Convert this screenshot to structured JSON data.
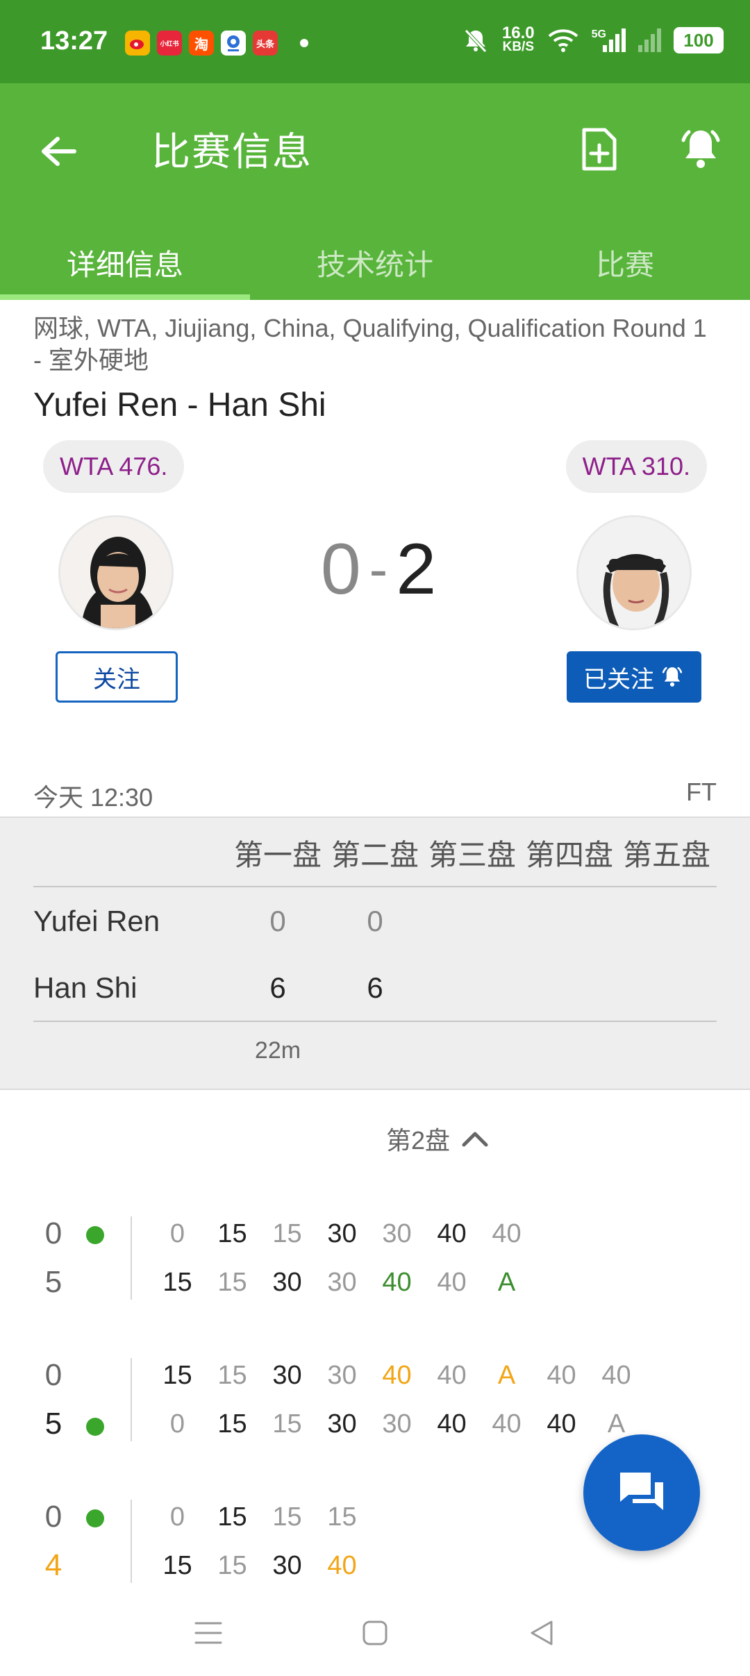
{
  "status_bar": {
    "time": "13:27",
    "apps": [
      {
        "icon": "weibo-icon",
        "label": "",
        "color": "#f7b500"
      },
      {
        "icon": "xiaohongshu-icon",
        "label": "小红书",
        "color": "#e8263b"
      },
      {
        "icon": "taobao-icon",
        "label": "淘",
        "color": "#ff5000"
      },
      {
        "icon": "tv-app-icon",
        "label": "",
        "color": "#2c6fd6"
      },
      {
        "icon": "toutiao-icon",
        "label": "头条",
        "color": "#e53935"
      }
    ],
    "net_speed_value": "16.0",
    "net_speed_unit": "KB/S",
    "network_type": "5G",
    "battery": "100"
  },
  "app_bar": {
    "title": "比赛信息",
    "tabs": [
      {
        "label": "详细信息",
        "active": true
      },
      {
        "label": "技术统计",
        "active": false
      },
      {
        "label": "比赛",
        "active": false
      }
    ]
  },
  "match": {
    "breadcrumb": "网球, WTA, Jiujiang, China, Qualifying, Qualification Round 1 - 室外硬地",
    "title": "Yufei Ren - Han Shi",
    "home": {
      "name": "Yufei Ren",
      "rank": "WTA 476.",
      "follow_label": "关注"
    },
    "away": {
      "name": "Han Shi",
      "rank": "WTA 310.",
      "follow_label": "已关注"
    },
    "score_home": "0",
    "score_separator": "-",
    "score_away": "2",
    "time": "今天 12:30",
    "status": "FT"
  },
  "sets": {
    "headers": [
      "第一盘",
      "第二盘",
      "第三盘",
      "第四盘",
      "第五盘"
    ],
    "rows": [
      {
        "name": "Yufei Ren",
        "values": [
          "0",
          "0"
        ]
      },
      {
        "name": "Han Shi",
        "values": [
          "6",
          "6"
        ]
      }
    ],
    "duration": "22m"
  },
  "point_by_point": {
    "toggle_label": "第2盘",
    "games": [
      {
        "top_score": "0",
        "bottom_score": "5",
        "bottom_style": "normal",
        "serve": "top",
        "top_points": [
          [
            "0",
            "n"
          ],
          [
            "15",
            "b"
          ],
          [
            "15",
            "n"
          ],
          [
            "30",
            "b"
          ],
          [
            "30",
            "n"
          ],
          [
            "40",
            "b"
          ],
          [
            "40",
            "n"
          ]
        ],
        "bottom_points": [
          [
            "15",
            "b"
          ],
          [
            "15",
            "n"
          ],
          [
            "30",
            "b"
          ],
          [
            "30",
            "n"
          ],
          [
            "40",
            "g"
          ],
          [
            "40",
            "n"
          ],
          [
            "A",
            "g"
          ]
        ]
      },
      {
        "top_score": "0",
        "bottom_score": "5",
        "bottom_style": "strong",
        "serve": "bottom",
        "top_points": [
          [
            "15",
            "b"
          ],
          [
            "15",
            "n"
          ],
          [
            "30",
            "b"
          ],
          [
            "30",
            "n"
          ],
          [
            "40",
            "o"
          ],
          [
            "40",
            "n"
          ],
          [
            "A",
            "o"
          ],
          [
            "40",
            "n"
          ],
          [
            "40",
            "n"
          ]
        ],
        "bottom_points": [
          [
            "0",
            "n"
          ],
          [
            "15",
            "b"
          ],
          [
            "15",
            "n"
          ],
          [
            "30",
            "b"
          ],
          [
            "30",
            "n"
          ],
          [
            "40",
            "b"
          ],
          [
            "40",
            "n"
          ],
          [
            "40",
            "b"
          ],
          [
            "A",
            "n"
          ]
        ]
      },
      {
        "top_score": "0",
        "bottom_score": "4",
        "bottom_style": "orange",
        "serve": "top",
        "top_points": [
          [
            "0",
            "n"
          ],
          [
            "15",
            "b"
          ],
          [
            "15",
            "n"
          ],
          [
            "15",
            "n"
          ]
        ],
        "bottom_points": [
          [
            "15",
            "b"
          ],
          [
            "15",
            "n"
          ],
          [
            "30",
            "b"
          ],
          [
            "40",
            "o"
          ]
        ]
      }
    ]
  },
  "colors": {
    "status_bar": "#3d9a2a",
    "app_bar": "#58b43b",
    "tab_indicator": "#9be87e",
    "rank_text": "#8e1f8a",
    "primary_blue": "#1464c8",
    "serve_dot": "#3aa72c",
    "highlight_orange": "#f2a516",
    "highlight_green": "#3c8d2f"
  },
  "icons": {
    "back": "arrow-left-icon",
    "add": "add-document-icon",
    "bell": "bell-ring-icon",
    "fab": "chat-icon",
    "collapse": "chevron-up-icon",
    "nav": [
      "menu-icon",
      "home-square-icon",
      "back-triangle-icon"
    ]
  }
}
